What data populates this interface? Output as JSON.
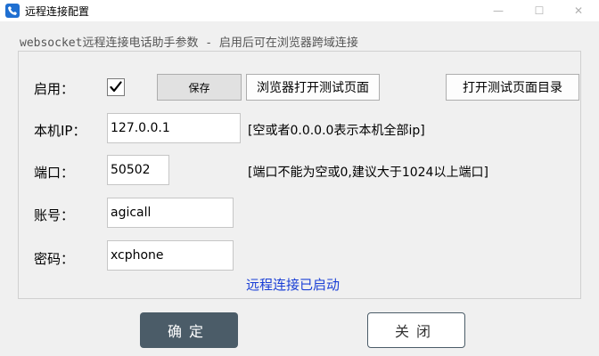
{
  "window": {
    "title": "远程连接配置",
    "minimize_glyph": "—",
    "maximize_glyph": "☐",
    "close_glyph": "✕"
  },
  "group": {
    "title": "websocket远程连接电话助手参数 - 启用后可在浏览器跨域连接"
  },
  "form": {
    "enable_label": "启用：",
    "enable_checked": true,
    "save_label": "保存",
    "open_test_page_label": "浏览器打开测试页面",
    "open_test_dir_label": "打开测试页面目录",
    "ip_label": "本机IP：",
    "ip_value": "127.0.0.1",
    "ip_hint": "[空或者0.0.0.0表示本机全部ip]",
    "port_label": "端口：",
    "port_value": "50502",
    "port_hint": "[端口不能为空或0,建议大于1024以上端口]",
    "account_label": "账号：",
    "account_value": "agicall",
    "password_label": "密码：",
    "password_value": "xcphone",
    "status": "远程连接已启动"
  },
  "footer": {
    "ok_label": "确定",
    "close_label": "关闭"
  },
  "colors": {
    "status_text": "#1a3fd6",
    "ok_button_bg": "#4b5c68"
  },
  "icons": {
    "app": "phone-icon",
    "check": "checkmark-icon"
  }
}
